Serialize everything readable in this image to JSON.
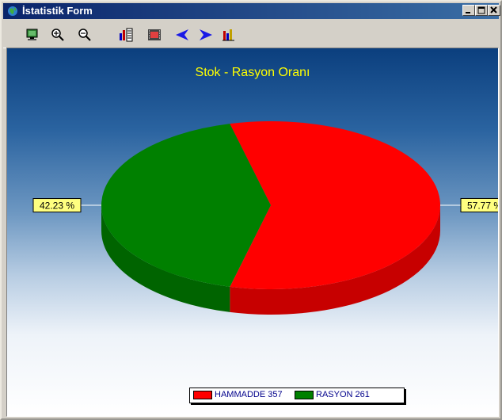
{
  "window": {
    "title": "İstatistik Form"
  },
  "toolbar": {
    "tools": [
      {
        "name": "view-chart-tool",
        "icon": "monitor-icon"
      },
      {
        "name": "zoom-in-tool",
        "icon": "zoom-in-icon"
      },
      {
        "name": "zoom-out-tool",
        "icon": "zoom-out-icon"
      },
      {
        "name": "edit-chart-tool",
        "icon": "chart-edit-icon"
      },
      {
        "name": "series-tool",
        "icon": "film-icon"
      },
      {
        "name": "previous-tool",
        "icon": "arrow-left-icon"
      },
      {
        "name": "next-tool",
        "icon": "arrow-right-icon"
      },
      {
        "name": "export-tool",
        "icon": "bar-chart-icon"
      }
    ]
  },
  "chart_data": {
    "type": "pie",
    "title": "Stok - Rasyon Oranı",
    "categories": [
      "HAMMADDE",
      "RASYON"
    ],
    "values": [
      357,
      261
    ],
    "colors": [
      "#ff0000",
      "#008000"
    ],
    "percent_labels": [
      "57.77 %",
      "42.23 %"
    ],
    "legend_labels": [
      "HAMMADDE 357",
      "RASYON 261"
    ],
    "legend_position": "bottom",
    "three_d": true
  },
  "colors": {
    "title": "#ffff00",
    "label_bg": "#ffff80",
    "legend_text": "#00008b"
  }
}
